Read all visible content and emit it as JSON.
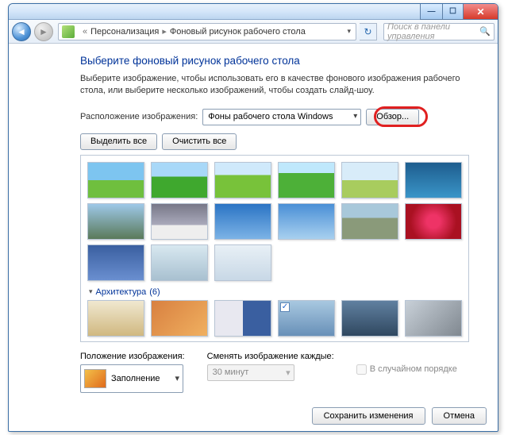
{
  "window": {
    "breadcrumb_root": "Персонализация",
    "breadcrumb_current": "Фоновый рисунок рабочего стола",
    "search_placeholder": "Поиск в панели управления"
  },
  "page": {
    "title": "Выберите фоновый рисунок рабочего стола",
    "subtitle": "Выберите изображение, чтобы использовать его в качестве фонового изображения рабочего стола, или выберите несколько изображений, чтобы создать слайд-шоу."
  },
  "location": {
    "label": "Расположение изображения:",
    "selected": "Фоны рабочего стола Windows",
    "browse": "Обзор..."
  },
  "selection": {
    "select_all": "Выделить все",
    "clear_all": "Очистить все"
  },
  "category": {
    "name": "Архитектура",
    "count": "(6)"
  },
  "thumbs_row1": [
    "t-sky-green",
    "t-field",
    "t-grass",
    "t-green",
    "t-plains"
  ],
  "thumbs_row2": [
    "t-underwater",
    "t-mountains",
    "t-waterfall",
    "t-clouds",
    "t-bluesky"
  ],
  "thumbs_row3": [
    "t-beachrocks",
    "t-pinkflowers",
    "t-blueflowers",
    "t-winterberries",
    "t-snowbranch"
  ],
  "thumbs_arch": [
    "t-arch1",
    "t-arch2",
    "t-arch3",
    "t-arch4",
    "t-arch5",
    "t-arch6"
  ],
  "arch_checked_index": 3,
  "position": {
    "label": "Положение изображения:",
    "selected": "Заполнение"
  },
  "interval": {
    "label": "Сменять изображение каждые:",
    "selected": "30 минут"
  },
  "shuffle": {
    "label": "В случайном порядке"
  },
  "footer": {
    "save": "Сохранить изменения",
    "cancel": "Отмена"
  }
}
